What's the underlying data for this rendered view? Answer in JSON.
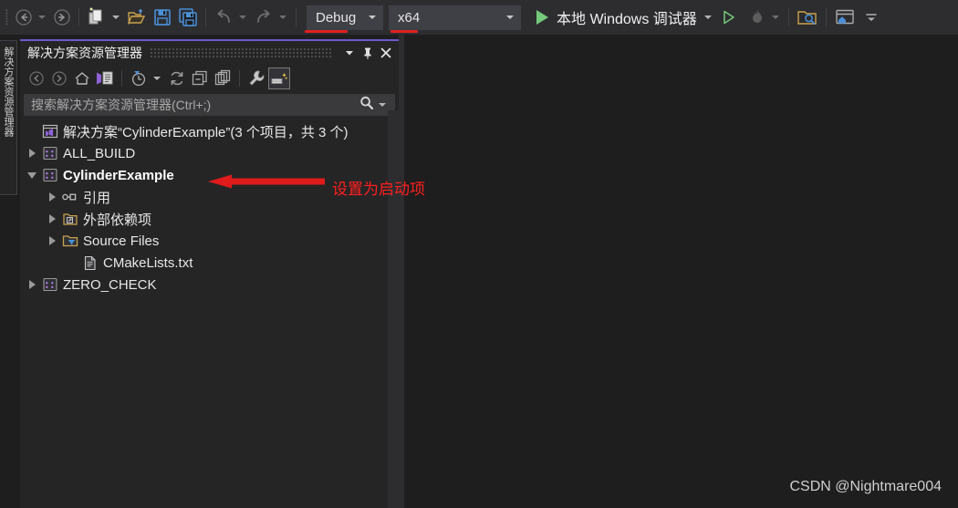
{
  "window": {
    "background": "#1e1e1e",
    "accent_purple": "#6a5acd",
    "annotation_red": "#ff1f1f"
  },
  "toolbar": {
    "nav_back": "navigate-backward",
    "nav_forward": "navigate-forward",
    "new_item": "new-item",
    "open_file": "open-file",
    "save": "save",
    "save_all": "save-all",
    "undo": "undo",
    "redo": "redo",
    "config_label": "Debug",
    "platform_label": "x64",
    "run_label": "本地 Windows 调试器",
    "start_no_debug": "start-without-debugging",
    "hot_reload": "hot-reload",
    "find_in_files": "find-in-files",
    "window_layout": "window-layout",
    "overflow": "toolbar-overflow"
  },
  "dock_tab": {
    "label": "解决方案资源管理器"
  },
  "solution_explorer": {
    "title": "解决方案资源管理器",
    "title_dropdown": "window-dropdown",
    "pin": "pin",
    "close": "close",
    "toolbar": {
      "back": "back",
      "forward": "forward",
      "home": "home",
      "switch_views": "switch-views",
      "pending_changes": "pending-changes",
      "refresh": "refresh",
      "collapse_all": "collapse-all",
      "show_all_files": "show-all-files",
      "properties": "properties",
      "preview_selected": "preview-selected-items"
    },
    "search": {
      "placeholder": "搜索解决方案资源管理器(Ctrl+;)",
      "value": "",
      "icon": "search-icon",
      "dropdown": "search-options"
    },
    "tree": [
      {
        "label": "解决方案“CylinderExample”(3 个项目，共 3 个)",
        "indent": 0,
        "twisty": "none",
        "icon": "solution-icon",
        "bold": false
      },
      {
        "label": "ALL_BUILD",
        "indent": 0,
        "twisty": "closed",
        "icon": "cpp-project-icon",
        "bold": false
      },
      {
        "label": "CylinderExample",
        "indent": 0,
        "twisty": "open",
        "icon": "cpp-project-icon",
        "bold": true
      },
      {
        "label": "引用",
        "indent": 1,
        "twisty": "closed",
        "icon": "references-icon",
        "bold": false
      },
      {
        "label": "外部依赖项",
        "indent": 1,
        "twisty": "closed",
        "icon": "external-dependencies-icon",
        "bold": false
      },
      {
        "label": "Source Files",
        "indent": 1,
        "twisty": "closed",
        "icon": "filter-folder-icon",
        "bold": false
      },
      {
        "label": "CMakeLists.txt",
        "indent": 1,
        "twisty": "none",
        "icon": "text-file-icon",
        "bold": false
      },
      {
        "label": "ZERO_CHECK",
        "indent": 0,
        "twisty": "closed",
        "icon": "cpp-project-icon",
        "bold": false
      }
    ]
  },
  "annotation": {
    "text": "设置为启动项",
    "arrow": "red-arrow-left"
  },
  "watermark": {
    "text": "CSDN @Nightmare004"
  }
}
